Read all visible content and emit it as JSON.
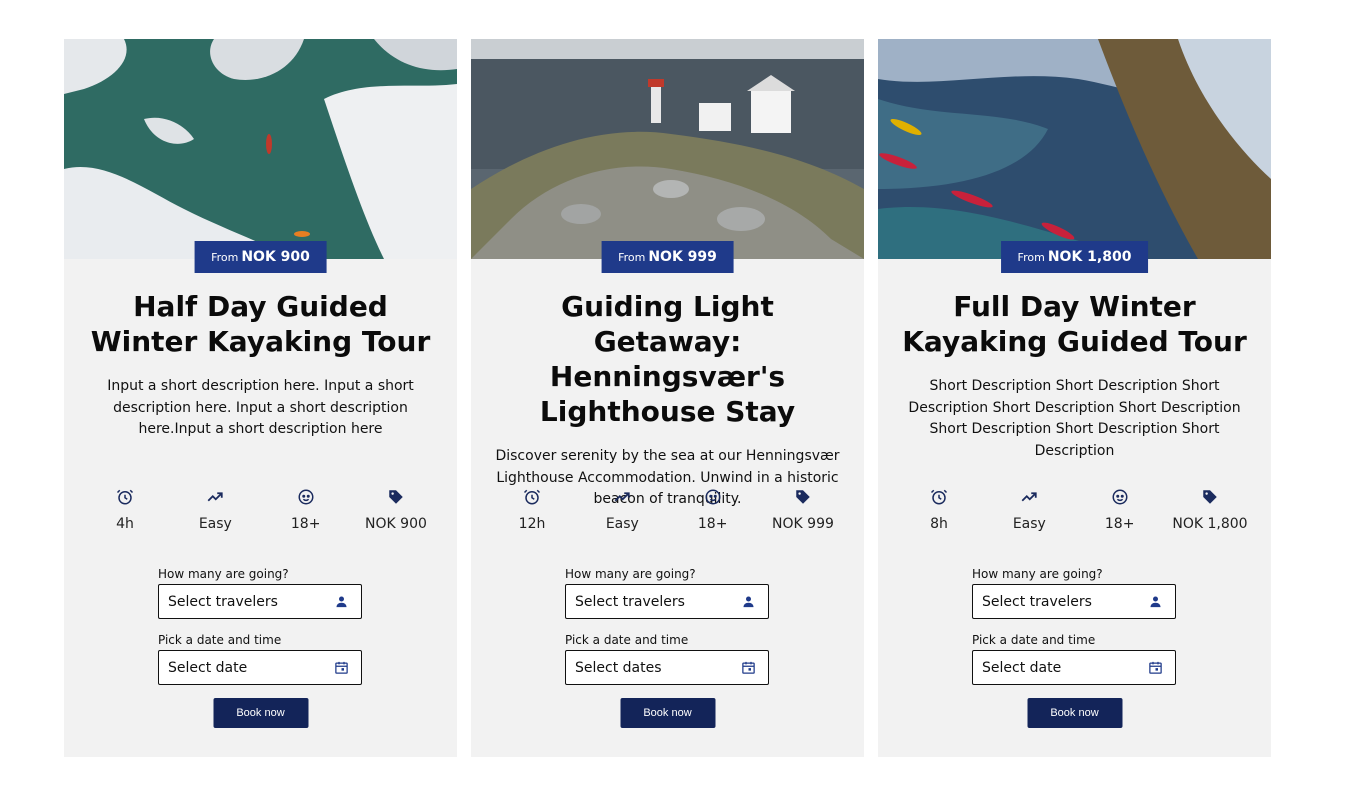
{
  "colors": {
    "accent": "#1f3a8a",
    "button": "#132459",
    "card_bg": "#f2f2f2"
  },
  "cards": [
    {
      "photo": "aerial-kayak-snow-coast",
      "price_prefix": "From",
      "price": "NOK 900",
      "title": "Half Day Guided Winter Kayaking Tour",
      "description": "Input a short description here. Input a short description here. Input a short description here.Input a short description here",
      "features": {
        "duration": "4h",
        "difficulty": "Easy",
        "age": "18+",
        "price": "NOK 900"
      },
      "travelers_label": "How many are going?",
      "travelers_placeholder": "Select travelers",
      "date_label": "Pick a date and time",
      "date_placeholder": "Select date",
      "book_label": "Book now"
    },
    {
      "photo": "lighthouse-island",
      "price_prefix": "From",
      "price": "NOK 999",
      "title": "Guiding Light Getaway: Henningsvær's Lighthouse Stay",
      "description": "Discover serenity by the sea at our Henningsvær Lighthouse Accommodation. Unwind in a historic beacon of tranquility.",
      "features": {
        "duration": "12h",
        "difficulty": "Easy",
        "age": "18+",
        "price": "NOK 999"
      },
      "travelers_label": "How many are going?",
      "travelers_placeholder": "Select travelers",
      "date_label": "Pick a date and time",
      "date_placeholder": "Select dates",
      "book_label": "Book now"
    },
    {
      "photo": "aerial-red-kayaks",
      "price_prefix": "From",
      "price": "NOK 1,800",
      "title": "Full Day Winter Kayaking Guided Tour",
      "description": "Short Description Short Description Short Description Short Description Short Description Short Description Short Description Short Description",
      "features": {
        "duration": "8h",
        "difficulty": "Easy",
        "age": "18+",
        "price": "NOK 1,800"
      },
      "travelers_label": "How many are going?",
      "travelers_placeholder": "Select travelers",
      "date_label": "Pick a date and time",
      "date_placeholder": "Select date",
      "book_label": "Book now"
    }
  ]
}
